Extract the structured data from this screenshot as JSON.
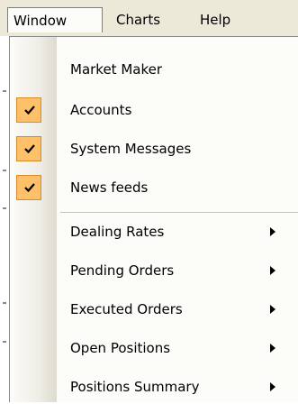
{
  "menubar": {
    "items": [
      {
        "label": "Window",
        "active": true
      },
      {
        "label": "Charts",
        "active": false
      },
      {
        "label": "Help",
        "active": false
      }
    ]
  },
  "dropdown": {
    "checked_group": [
      {
        "label": "Market Maker",
        "checked": false
      },
      {
        "label": "Accounts",
        "checked": true
      },
      {
        "label": "System Messages",
        "checked": true
      },
      {
        "label": "News feeds",
        "checked": true
      }
    ],
    "submenu_group": [
      {
        "label": "Dealing Rates",
        "has_submenu": true
      },
      {
        "label": "Pending Orders",
        "has_submenu": true
      },
      {
        "label": "Executed Orders",
        "has_submenu": true
      },
      {
        "label": "Open Positions",
        "has_submenu": true
      },
      {
        "label": "Positions Summary",
        "has_submenu": true
      }
    ]
  },
  "colors": {
    "check_highlight": "#ffc06a",
    "check_border": "#d58a2c",
    "menu_background": "#fcfcf9",
    "menubar_background": "#ece9d8"
  },
  "icons": {
    "check": "check-icon",
    "submenu": "chevron-right-icon"
  }
}
